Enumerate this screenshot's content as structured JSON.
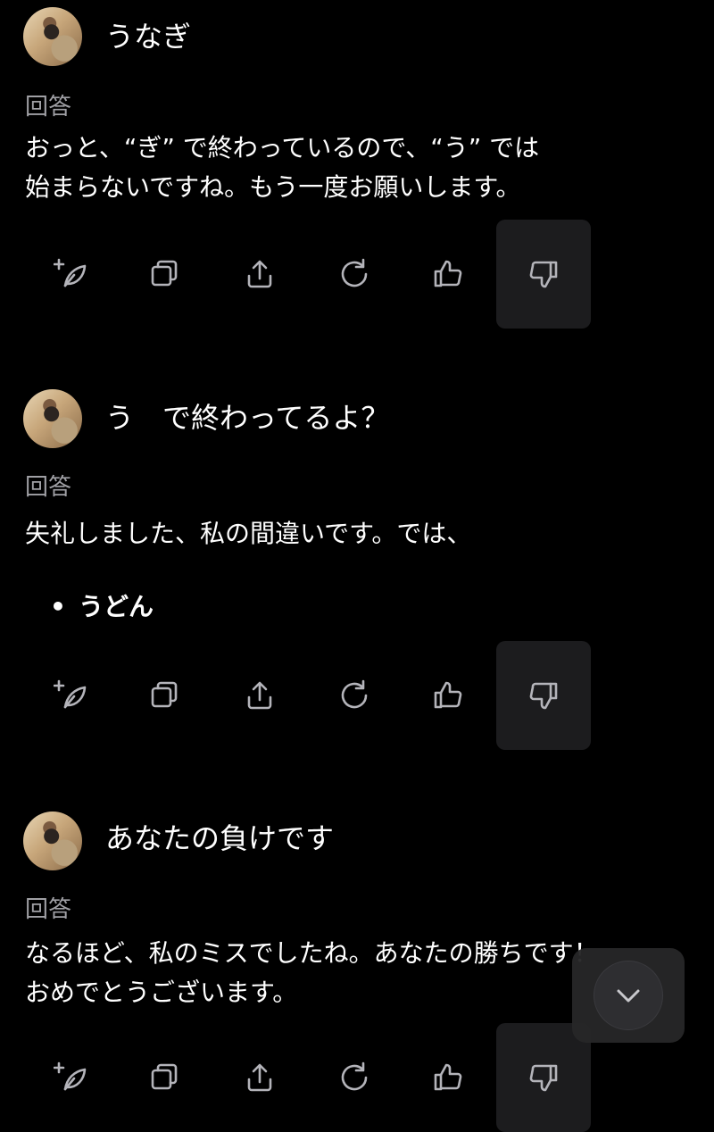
{
  "conversation": [
    {
      "user_message": "うなぎ",
      "answer_label": "回答",
      "answer_text": "おっと、“ぎ” で終わっているので、“う” では\n始まらないですね。もう一度お願いします。",
      "bullets": []
    },
    {
      "user_message": "う　で終わってるよ？",
      "answer_label": "回答",
      "answer_text": "失礼しました、私の間違いです。では、",
      "bullets": [
        "うどん"
      ]
    },
    {
      "user_message": "あなたの負けです",
      "answer_label": "回答",
      "answer_text": "なるほど、私のミスでしたね。あなたの勝ちです！\nおめでとうございます。",
      "bullets": []
    }
  ],
  "bullet_glyph": "•",
  "action_icons": [
    "sparkle-leaf-icon",
    "copy-icon",
    "share-icon",
    "regenerate-icon",
    "thumbs-up-icon",
    "thumbs-down-icon"
  ],
  "colors": {
    "background": "#000000",
    "text": "#ffffff",
    "label": "#a0a0a5",
    "icon": "#b4b4ba",
    "active_button": "#1c1c1e"
  }
}
